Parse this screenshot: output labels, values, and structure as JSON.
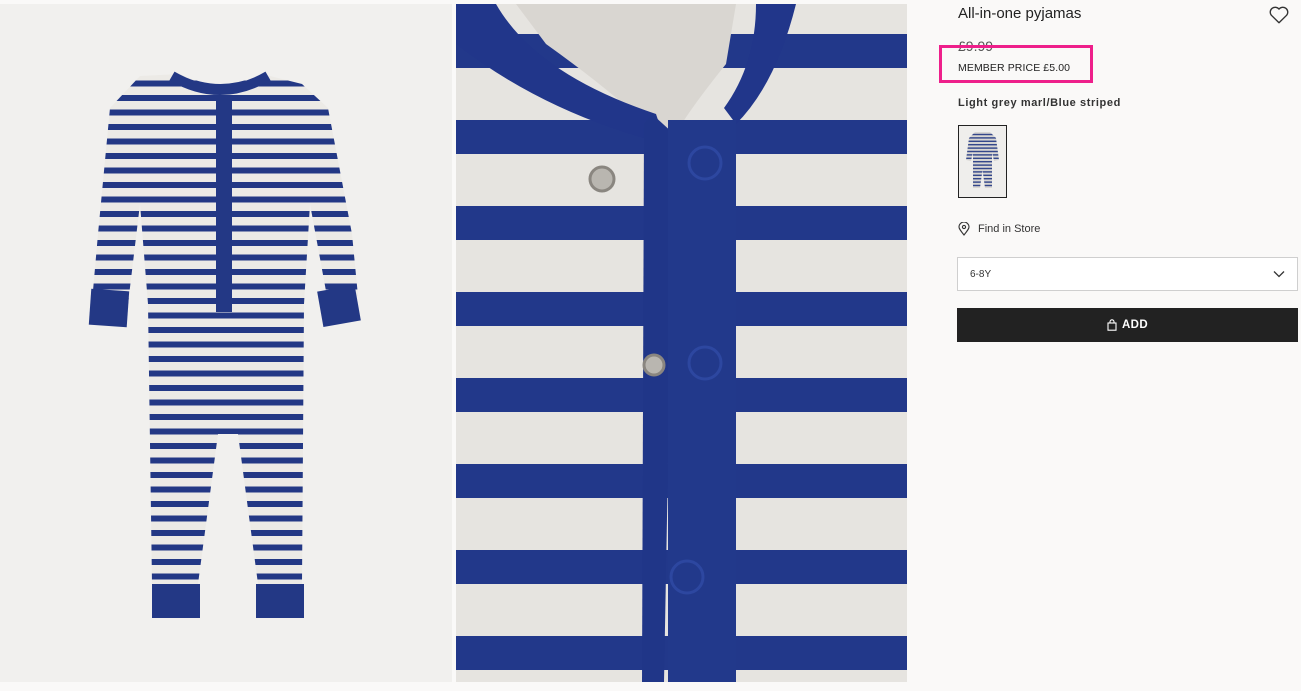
{
  "product": {
    "title": "All-in-one pyjamas",
    "original_price": "£9.99",
    "member_price": "MEMBER PRICE £5.00",
    "color_name": "Light grey marl/Blue striped",
    "find_in_store": "Find in Store",
    "size_selected": "6-8Y",
    "add_label": "ADD"
  },
  "icons": {
    "favorite": "heart-icon",
    "store": "location-pin-icon",
    "dropdown": "chevron-down-icon",
    "bag": "shopping-bag-icon"
  },
  "colors": {
    "highlight": "#ee1f8b",
    "button": "#222222",
    "stripe_blue": "#253a84",
    "fabric_grey": "#e8e6e2"
  }
}
